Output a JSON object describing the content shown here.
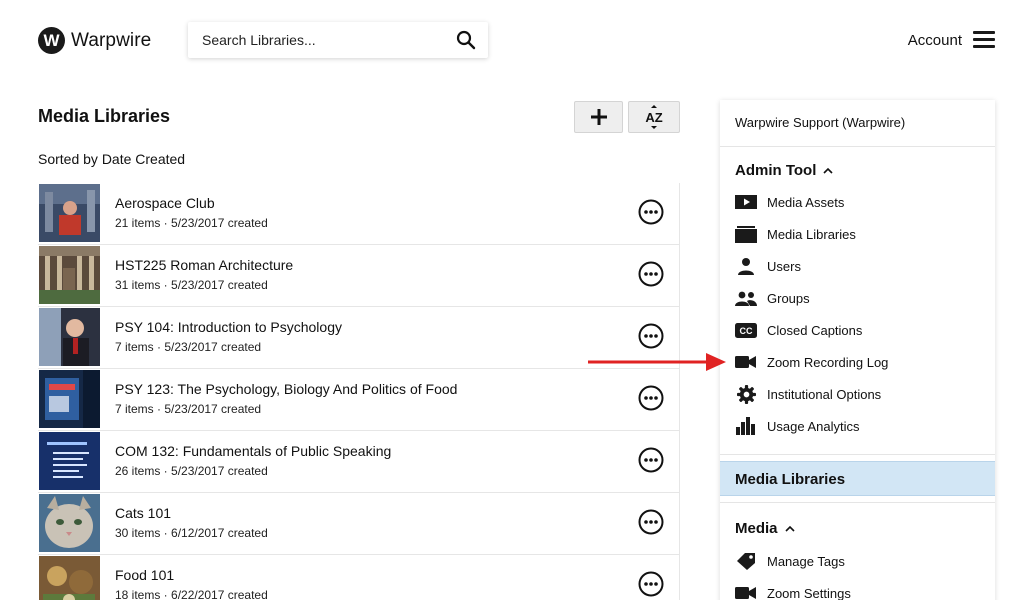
{
  "brand": {
    "logo_letter": "W",
    "name": "Warpwire"
  },
  "search": {
    "placeholder": "Search Libraries..."
  },
  "header": {
    "account_label": "Account"
  },
  "main": {
    "title": "Media Libraries",
    "sorted_label": "Sorted by Date Created",
    "libraries": [
      {
        "title": "Aerospace Club",
        "meta": "21 items · 5/23/2017 created"
      },
      {
        "title": "HST225 Roman Architecture",
        "meta": "31 items · 5/23/2017 created"
      },
      {
        "title": "PSY 104: Introduction to Psychology",
        "meta": "7 items · 5/23/2017 created"
      },
      {
        "title": "PSY 123: The Psychology, Biology And Politics of Food",
        "meta": "7 items · 5/23/2017 created"
      },
      {
        "title": "COM 132: Fundamentals of Public Speaking",
        "meta": "26 items · 5/23/2017 created"
      },
      {
        "title": "Cats 101",
        "meta": "30 items · 6/12/2017 created"
      },
      {
        "title": "Food 101",
        "meta": "18 items · 6/22/2017 created"
      }
    ]
  },
  "panel": {
    "user": "Warpwire Support (Warpwire)",
    "admin_title": "Admin Tool",
    "admin_items": [
      {
        "label": "Media Assets",
        "icon": "media-assets-icon"
      },
      {
        "label": "Media Libraries",
        "icon": "media-libraries-icon"
      },
      {
        "label": "Users",
        "icon": "user-icon"
      },
      {
        "label": "Groups",
        "icon": "groups-icon"
      },
      {
        "label": "Closed Captions",
        "icon": "closed-captions-icon"
      },
      {
        "label": "Zoom Recording Log",
        "icon": "video-camera-icon"
      },
      {
        "label": "Institutional Options",
        "icon": "gear-icon"
      },
      {
        "label": "Usage Analytics",
        "icon": "bar-chart-icon"
      }
    ],
    "active_label": "Media Libraries",
    "media_title": "Media",
    "media_items": [
      {
        "label": "Manage Tags",
        "icon": "tag-icon"
      },
      {
        "label": "Zoom Settings",
        "icon": "video-camera-icon"
      }
    ],
    "cc_text": "CC"
  },
  "colors": {
    "highlight": "#d2e6f5",
    "arrow": "#e02222",
    "text": "#111111"
  }
}
